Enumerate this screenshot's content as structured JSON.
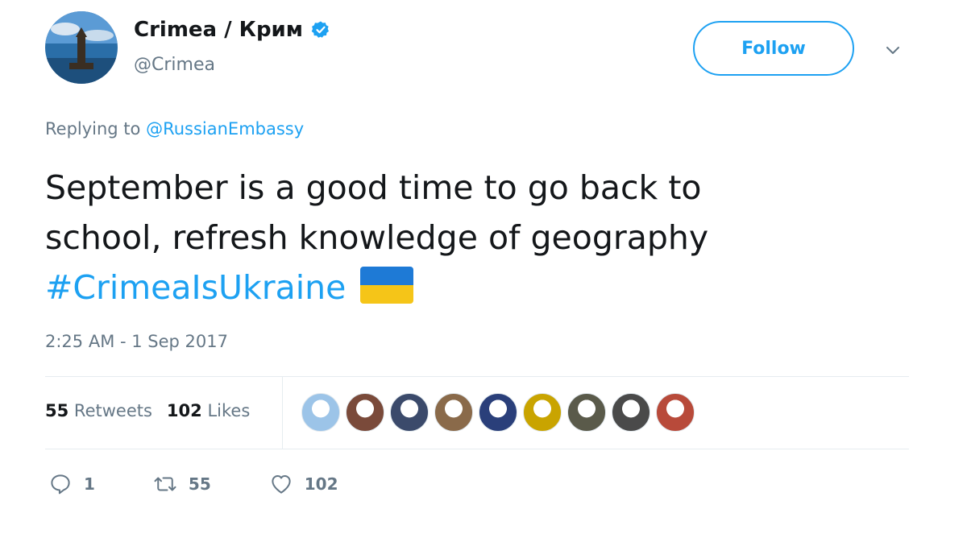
{
  "author": {
    "display_name": "Crimea / Крим",
    "handle": "@Crimea",
    "verified_icon": "verified-badge-icon"
  },
  "follow": {
    "label": "Follow"
  },
  "reply": {
    "prefix": "Replying to ",
    "target": "@RussianEmbassy"
  },
  "tweet": {
    "lines": [
      "September is a good time to go back to",
      "school, refresh knowledge of geography"
    ],
    "hashtag": "#CrimeaIsUkraine",
    "emoji_name": "ukraine-flag"
  },
  "timestamp": "2:25 AM - 1 Sep 2017",
  "stats": {
    "retweets_count": "55",
    "retweets_label": "Retweets",
    "likes_count": "102",
    "likes_label": "Likes"
  },
  "liker_avatars": [
    "#9cc4e8",
    "#7a4a3a",
    "#3b4a6b",
    "#8a6a4a",
    "#2a3f7a",
    "#c9a400",
    "#5a5a4a",
    "#4a4a4a",
    "#b84a3a"
  ],
  "actions": {
    "reply_count": "1",
    "retweet_count": "55",
    "like_count": "102"
  },
  "colors": {
    "accent": "#1da1f2",
    "muted": "#657786",
    "flag_blue": "#1e7ad6",
    "flag_yellow": "#f5c518"
  }
}
